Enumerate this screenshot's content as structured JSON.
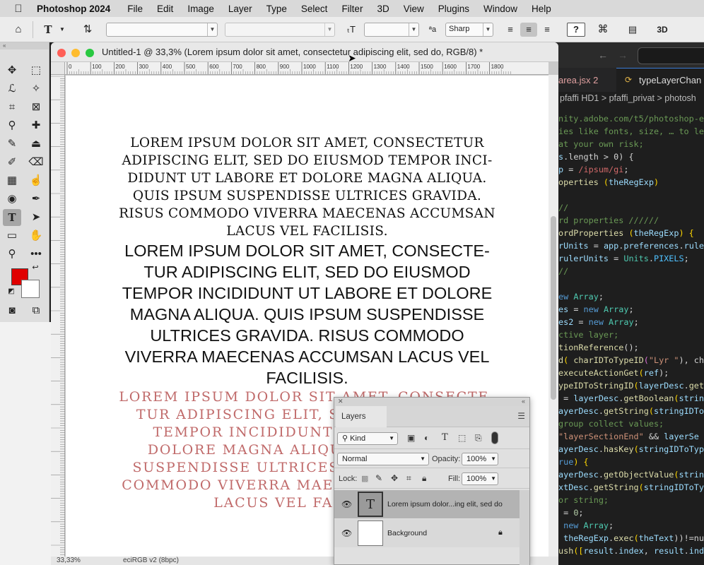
{
  "menubar": {
    "app": "Photoshop 2024",
    "items": [
      "File",
      "Edit",
      "Image",
      "Layer",
      "Type",
      "Select",
      "Filter",
      "3D",
      "View",
      "Plugins",
      "Window",
      "Help"
    ]
  },
  "options": {
    "antialias": "Sharp",
    "mode3d": "3D"
  },
  "document": {
    "title": "Untitled-1 @ 33,3% (Lorem ipsum dolor sit amet, consectetur adipiscing elit, sed do, RGB/8) *",
    "zoom": "33,33%",
    "profile": "eciRGB v2 (8bpc)",
    "ruler_labels": [
      "0",
      "100",
      "200",
      "300",
      "400",
      "500",
      "600",
      "700",
      "800",
      "900",
      "1000",
      "1100",
      "1200",
      "1300",
      "1400",
      "1500",
      "1600",
      "1700",
      "1800"
    ],
    "text_serif": [
      "LOREM IPSUM DOLOR SIT AMET, CONSECTETUR",
      "ADIPISCING ELIT, SED DO EIUSMOD TEMPOR INCI-",
      "DIDUNT UT LABORE ET DOLORE MAGNA ALIQUA.",
      "QUIS IPSUM SUSPENDISSE ULTRICES GRAVIDA.",
      "RISUS COMMODO VIVERRA MAECENAS ACCUMSAN",
      "LACUS VEL FACILISIS."
    ],
    "text_sans": [
      "LOREM IPSUM DOLOR SIT AMET, CONSECTE-",
      "TUR ADIPISCING ELIT, SED DO EIUSMOD",
      "TEMPOR INCIDIDUNT UT LABORE ET DOLORE",
      "MAGNA ALIQUA. QUIS IPSUM SUSPENDISSE",
      "ULTRICES GRAVIDA. RISUS COMMODO",
      "VIVERRA MAECENAS ACCUMSAN LACUS VEL",
      "FACILISIS."
    ],
    "text_pink": [
      "LOREM IPSUM DOLOR SIT AMET, CONSECTE-",
      "TUR ADIPISCING ELIT, SED DO EIUSMOD",
      "TEMPOR INCIDIDUNT UT LABORE ET",
      "DOLORE MAGNA ALIQUA. QUIS IPSUM",
      "SUSPENDISSE ULTRICES GRAVIDA. RISUS",
      "COMMODO VIVERRA MAECENAS ACCUMSAN",
      "LACUS VEL FACILISIS."
    ]
  },
  "colors": {
    "foreground": "#e00000",
    "background": "#ffffff",
    "pink_text": "#c06a6a"
  },
  "editor": {
    "tab1": "area.jsx 2",
    "tab2": "typeLayerChan",
    "breadcrumb": "pfaffi HD1 > pfaffi_privat > photosh",
    "lines": [
      [
        [
          "nity.adobe.com/t5/photoshop-e",
          "#6a9955"
        ]
      ],
      [
        [
          "ies like fonts, size, … to le",
          "#6a9955"
        ]
      ],
      [
        [
          "at your own risk;",
          "#6a9955"
        ]
      ],
      [
        [
          "s",
          "#9cdcfe"
        ],
        [
          ".length > 0) {",
          "#d4d4d4"
        ]
      ],
      [
        [
          "p",
          "#9cdcfe"
        ],
        [
          " = ",
          "#d4d4d4"
        ],
        [
          "/ipsum/gi",
          "#d16969"
        ],
        [
          ";",
          "#d4d4d4"
        ]
      ],
      [
        [
          "operties ",
          "#dcdcaa"
        ],
        [
          "(",
          "#ffd700"
        ],
        [
          "theRegExp",
          "#9cdcfe"
        ],
        [
          ")",
          "#ffd700"
        ]
      ],
      [
        [
          "",
          ""
        ]
      ],
      [
        [
          "//",
          "#6a9955"
        ]
      ],
      [
        [
          "rd properties //////",
          "#6a9955"
        ]
      ],
      [
        [
          "ordProperties ",
          "#dcdcaa"
        ],
        [
          "(",
          "#ffd700"
        ],
        [
          "theRegExp",
          "#9cdcfe"
        ],
        [
          ") {",
          "#ffd700"
        ]
      ],
      [
        [
          "rUnits",
          "#9cdcfe"
        ],
        [
          " = ",
          "#d4d4d4"
        ],
        [
          "app",
          "#9cdcfe"
        ],
        [
          ".",
          "#d4d4d4"
        ],
        [
          "preferences",
          "#9cdcfe"
        ],
        [
          ".",
          "#d4d4d4"
        ],
        [
          "rule",
          "#9cdcfe"
        ]
      ],
      [
        [
          "rulerUnits",
          "#9cdcfe"
        ],
        [
          " = ",
          "#d4d4d4"
        ],
        [
          "Units",
          "#4ec9b0"
        ],
        [
          ".",
          "#d4d4d4"
        ],
        [
          "PIXELS",
          "#4fc1ff"
        ],
        [
          ";",
          "#d4d4d4"
        ]
      ],
      [
        [
          "//",
          "#6a9955"
        ]
      ],
      [
        [
          "",
          ""
        ]
      ],
      [
        [
          "ew ",
          "#569cd6"
        ],
        [
          "Array",
          "#4ec9b0"
        ],
        [
          ";",
          "#d4d4d4"
        ]
      ],
      [
        [
          "es",
          "#9cdcfe"
        ],
        [
          " = ",
          "#d4d4d4"
        ],
        [
          "new ",
          "#569cd6"
        ],
        [
          "Array",
          "#4ec9b0"
        ],
        [
          ";",
          "#d4d4d4"
        ]
      ],
      [
        [
          "es2",
          "#9cdcfe"
        ],
        [
          " = ",
          "#d4d4d4"
        ],
        [
          "new ",
          "#569cd6"
        ],
        [
          "Array",
          "#4ec9b0"
        ],
        [
          ";",
          "#d4d4d4"
        ]
      ],
      [
        [
          "ctive layer;",
          "#6a9955"
        ]
      ],
      [
        [
          "tionReference",
          "#dcdcaa"
        ],
        [
          "();",
          "#d4d4d4"
        ]
      ],
      [
        [
          "d",
          "#dcdcaa"
        ],
        [
          "( ",
          "#ffd700"
        ],
        [
          "charIDToTypeID",
          "#dcdcaa"
        ],
        [
          "(",
          "#da70d6"
        ],
        [
          "\"Lyr \"",
          "#ce9178"
        ],
        [
          "), ch",
          "#d4d4d4"
        ]
      ],
      [
        [
          "executeActionGet",
          "#dcdcaa"
        ],
        [
          "(",
          "#ffd700"
        ],
        [
          "ref",
          "#9cdcfe"
        ],
        [
          ");",
          "#d4d4d4"
        ]
      ],
      [
        [
          "ypeIDToStringID",
          "#dcdcaa"
        ],
        [
          "(",
          "#ffd700"
        ],
        [
          "layerDesc",
          "#9cdcfe"
        ],
        [
          ".",
          "#d4d4d4"
        ],
        [
          "get",
          "#dcdcaa"
        ]
      ],
      [
        [
          " = ",
          "#d4d4d4"
        ],
        [
          "layerDesc",
          "#9cdcfe"
        ],
        [
          ".",
          "#d4d4d4"
        ],
        [
          "getBoolean",
          "#dcdcaa"
        ],
        [
          "(",
          "#ffd700"
        ],
        [
          "strin",
          "#9cdcfe"
        ]
      ],
      [
        [
          "ayerDesc",
          "#9cdcfe"
        ],
        [
          ".",
          "#d4d4d4"
        ],
        [
          "getString",
          "#dcdcaa"
        ],
        [
          "(",
          "#ffd700"
        ],
        [
          "stringIDTo",
          "#9cdcfe"
        ]
      ],
      [
        [
          "group collect values;",
          "#6a9955"
        ]
      ],
      [
        [
          "\"layerSectionEnd\"",
          "#ce9178"
        ],
        [
          " && ",
          "#d4d4d4"
        ],
        [
          "layerSe",
          "#9cdcfe"
        ]
      ],
      [
        [
          "ayerDesc",
          "#9cdcfe"
        ],
        [
          ".",
          "#d4d4d4"
        ],
        [
          "hasKey",
          "#dcdcaa"
        ],
        [
          "(",
          "#ffd700"
        ],
        [
          "stringIDToType",
          "#9cdcfe"
        ]
      ],
      [
        [
          "rue",
          "#569cd6"
        ],
        [
          ") {",
          "#ffd700"
        ]
      ],
      [
        [
          "ayerDesc",
          "#9cdcfe"
        ],
        [
          ".",
          "#d4d4d4"
        ],
        [
          "getObjectValue",
          "#dcdcaa"
        ],
        [
          "(",
          "#ffd700"
        ],
        [
          "strin",
          "#9cdcfe"
        ]
      ],
      [
        [
          "xtDesc",
          "#9cdcfe"
        ],
        [
          ".",
          "#d4d4d4"
        ],
        [
          "getString",
          "#dcdcaa"
        ],
        [
          "(",
          "#ffd700"
        ],
        [
          "stringIDToTy",
          "#9cdcfe"
        ]
      ],
      [
        [
          "or string;",
          "#6a9955"
        ]
      ],
      [
        [
          " = ",
          "#d4d4d4"
        ],
        [
          "0",
          "#b5cea8"
        ],
        [
          ";",
          "#d4d4d4"
        ]
      ],
      [
        [
          " new ",
          "#569cd6"
        ],
        [
          "Array",
          "#4ec9b0"
        ],
        [
          ";",
          "#d4d4d4"
        ]
      ],
      [
        [
          " theRegExp",
          "#9cdcfe"
        ],
        [
          ".",
          "#d4d4d4"
        ],
        [
          "exec",
          "#dcdcaa"
        ],
        [
          "(",
          "#ffd700"
        ],
        [
          "theText",
          "#9cdcfe"
        ],
        [
          "))!=nu",
          "#d4d4d4"
        ]
      ],
      [
        [
          "ush",
          "#dcdcaa"
        ],
        [
          "([",
          "#ffd700"
        ],
        [
          "result",
          "#9cdcfe"
        ],
        [
          ".",
          "#d4d4d4"
        ],
        [
          "index",
          "#9cdcfe"
        ],
        [
          ", ",
          "#d4d4d4"
        ],
        [
          "result",
          "#9cdcfe"
        ],
        [
          ".",
          "#d4d4d4"
        ],
        [
          "ind",
          "#9cdcfe"
        ]
      ]
    ]
  },
  "layers_panel": {
    "title": "Layers",
    "filter": "Kind",
    "blend": "Normal",
    "opacity_label": "Opacity:",
    "opacity": "100%",
    "lock_label": "Lock:",
    "fill_label": "Fill:",
    "fill": "100%",
    "layers": [
      {
        "name": "Lorem ipsum dolor...ing elit, sed do",
        "thumb": "T",
        "selected": true
      },
      {
        "name": "Background",
        "thumb": "",
        "selected": false
      }
    ]
  }
}
